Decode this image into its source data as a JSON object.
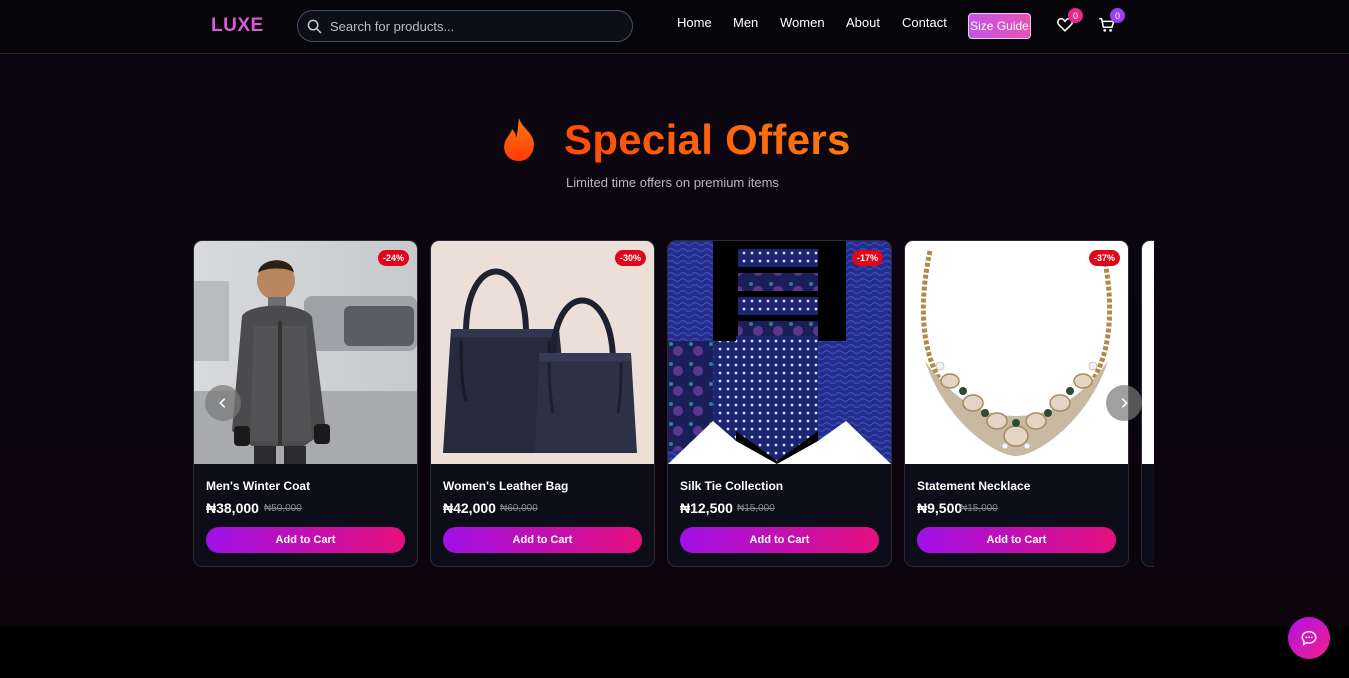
{
  "header": {
    "logo": "LUXE",
    "search_placeholder": "Search for products...",
    "nav": [
      "Home",
      "Men",
      "Women",
      "About",
      "Contact"
    ],
    "size_guide": "Size Guide",
    "wishlist_count": "0",
    "cart_count": "0"
  },
  "offers": {
    "title": "Special Offers",
    "subtitle": "Limited time offers on premium items",
    "products": [
      {
        "name": "Men's Winter Coat",
        "price": "₦38,000",
        "old_price": "₦50,000",
        "discount": "-24%",
        "button": "Add to Cart",
        "icon": "coat-photo"
      },
      {
        "name": "Women's Leather Bag",
        "price": "₦42,000",
        "old_price": "₦60,000",
        "discount": "-30%",
        "button": "Add to Cart",
        "icon": "bag-photo"
      },
      {
        "name": "Silk Tie Collection",
        "price": "₦12,500",
        "old_price": "₦15,000",
        "discount": "-17%",
        "button": "Add to Cart",
        "icon": "ties-photo"
      },
      {
        "name": "Statement Necklace",
        "price": "₦9,500",
        "old_price": "₦15,000",
        "discount": "-37%",
        "button": "Add to Cart",
        "icon": "necklace-photo"
      }
    ]
  },
  "colors": {
    "brand": "#d45cd0",
    "accent_orange": "#ff5a08",
    "button_start": "#a010e8",
    "button_end": "#e5107e",
    "discount": "#e0061a"
  }
}
